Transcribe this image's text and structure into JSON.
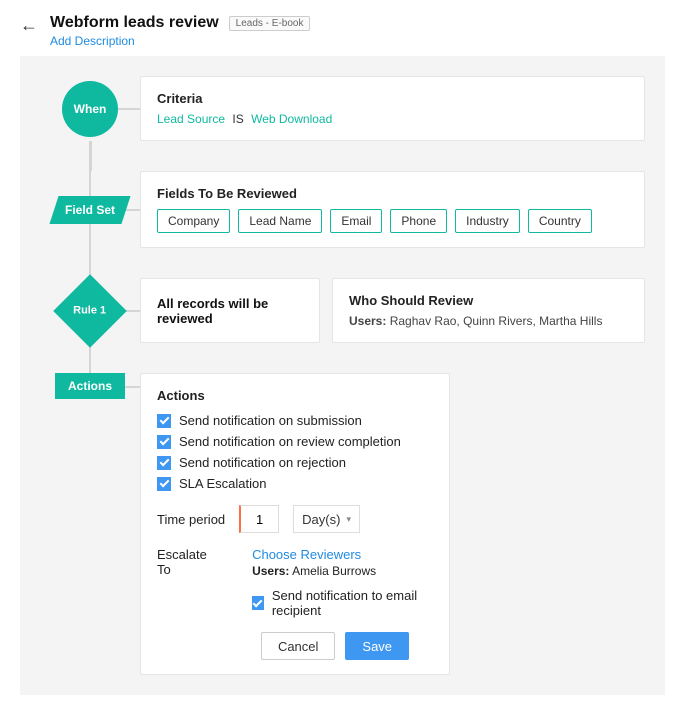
{
  "header": {
    "title": "Webform leads review",
    "badge": "Leads - E-book",
    "add_description": "Add Description"
  },
  "flow": {
    "when": {
      "node_label": "When",
      "card_title": "Criteria",
      "field": "Lead Source",
      "operator": "IS",
      "value": "Web Download"
    },
    "fieldset": {
      "node_label": "Field Set",
      "card_title": "Fields To Be Reviewed",
      "fields": [
        "Company",
        "Lead Name",
        "Email",
        "Phone",
        "Industry",
        "Country"
      ]
    },
    "rule": {
      "node_label": "Rule 1",
      "records_text": "All records will be reviewed",
      "who_title": "Who Should Review",
      "who_label": "Users:",
      "who_users": "Raghav Rao, Quinn Rivers, Martha Hills"
    },
    "actions": {
      "node_label": "Actions",
      "card_title": "Actions",
      "checks": [
        "Send notification on submission",
        "Send notification on review completion",
        "Send notification on rejection",
        "SLA Escalation"
      ],
      "time_label": "Time period",
      "time_value": "1",
      "time_unit": "Day(s)",
      "escalate_label": "Escalate To",
      "choose_reviewers": "Choose Reviewers",
      "escalate_users_label": "Users:",
      "escalate_users": "Amelia Burrows",
      "notify_label": "Send notification to email recipient",
      "cancel": "Cancel",
      "save": "Save"
    }
  }
}
